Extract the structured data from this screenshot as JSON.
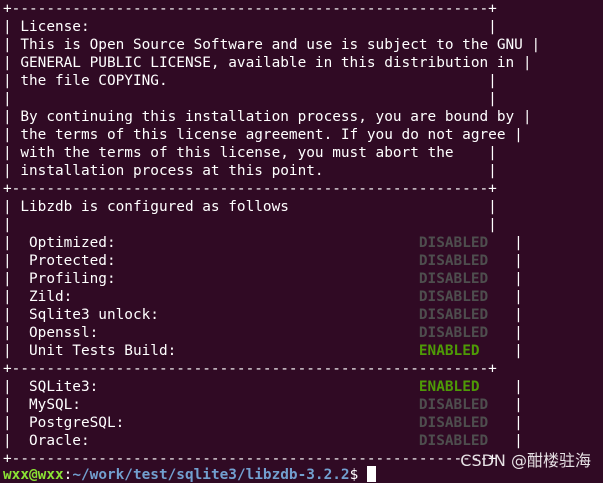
{
  "lines": {
    "l0": "+-------------------------------------------------------+",
    "l1": "| License:                                              |",
    "l2": "| This is Open Source Software and use is subject to the GNU |",
    "l3": "| GENERAL PUBLIC LICENSE, available in this distribution in |",
    "l4": "| the file COPYING.                                     |",
    "l5": "|                                                       |",
    "l6": "| By continuing this installation process, you are bound by |",
    "l7": "| the terms of this license agreement. If you do not agree |",
    "l8": "| with the terms of this license, you must abort the    |",
    "l9": "| installation process at this point.                   |",
    "l10": "+-------------------------------------------------------+",
    "l11": "| Libzdb is configured as follows                       |",
    "l12": "|                                                       |",
    "l13_label": "|  Optimized:                                   ",
    "l13_end": "   |",
    "l14_label": "|  Protected:                                   ",
    "l14_end": "   |",
    "l15_label": "|  Profiling:                                   ",
    "l15_end": "   |",
    "l16_label": "|  Zild:                                        ",
    "l16_end": "   |",
    "l17_label": "|  Sqlite3 unlock:                              ",
    "l17_end": "   |",
    "l18_label": "|  Openssl:                                     ",
    "l18_end": "   |",
    "l19_label": "|  Unit Tests Build:                            ",
    "l19_end": "    |",
    "l20": "+-------------------------------------------------------+",
    "l21_label": "|  SQLite3:                                     ",
    "l21_end": "    |",
    "l22_label": "|  MySQL:                                       ",
    "l22_end": "   |",
    "l23_label": "|  PostgreSQL:                                  ",
    "l23_end": "   |",
    "l24_label": "|  Oracle:                                      ",
    "l24_end": "   |",
    "l25": "+-------------------------------------------------------+"
  },
  "status": {
    "optimized": "DISABLED",
    "protected": "DISABLED",
    "profiling": "DISABLED",
    "zild": "DISABLED",
    "sqlite3_unlock": "DISABLED",
    "openssl": "DISABLED",
    "unit_tests_build": "ENABLED",
    "sqlite3": "ENABLED",
    "mysql": "DISABLED",
    "postgresql": "DISABLED",
    "oracle": "DISABLED"
  },
  "prompt": {
    "user_host": "wxx@wxx",
    "colon": ":",
    "path": "~/work/test/sqlite3/libzdb-3.2.2",
    "dollar": "$ "
  },
  "watermark": "CSDN @酣楼驻海",
  "colors": {
    "background": "#300a24",
    "text": "#ffffff",
    "disabled": "#4e4e4e",
    "enabled": "#4e9a06",
    "prompt_user": "#8ae234",
    "prompt_path": "#729fcf"
  }
}
